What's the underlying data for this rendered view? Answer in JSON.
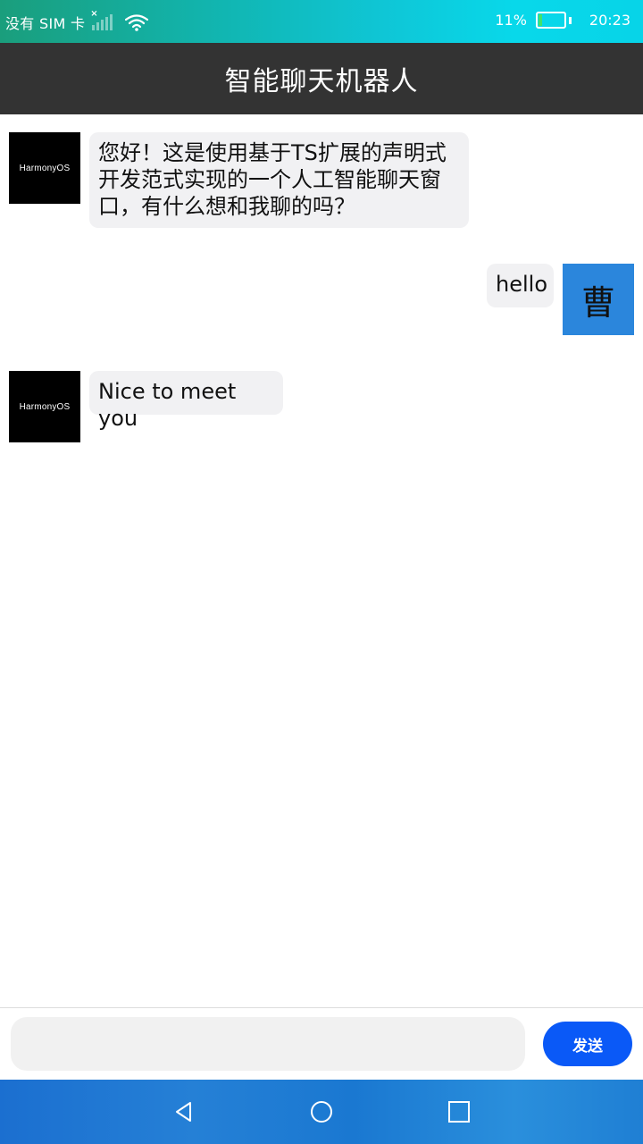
{
  "status_bar": {
    "sim_text": "没有 SIM 卡",
    "battery_percent": "11%",
    "battery_level": 0.11,
    "time": "20:23"
  },
  "header": {
    "title": "智能聊天机器人"
  },
  "messages": [
    {
      "sender": "bot",
      "avatar_text": "HarmonyOS",
      "text": "您好！这是使用基于TS扩展的声明式开发范式实现的一个人工智能聊天窗口，有什么想和我聊的吗？"
    },
    {
      "sender": "user",
      "avatar_text": "曹",
      "text": "hello"
    },
    {
      "sender": "bot",
      "avatar_text": "HarmonyOS",
      "text": "Nice to meet you"
    }
  ],
  "input": {
    "value": "",
    "placeholder": ""
  },
  "send_button": {
    "label": "发送"
  },
  "colors": {
    "title_bar_bg": "#333333",
    "bubble_bg": "#f1f1f3",
    "user_avatar_bg": "#2b86dc",
    "send_button_bg": "#0a59f7"
  },
  "icons": {
    "signal": "signal-icon",
    "wifi": "wifi-icon",
    "battery": "battery-icon",
    "nav_back": "back-triangle-icon",
    "nav_home": "home-circle-icon",
    "nav_recent": "recent-square-icon"
  }
}
